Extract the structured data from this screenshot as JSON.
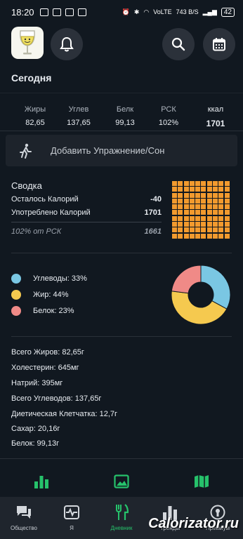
{
  "status": {
    "time": "18:20",
    "network": "VoLTE",
    "speed": "743 B/S",
    "battery": "42"
  },
  "title": "Сегодня",
  "macros": [
    {
      "label": "Жиры",
      "value": "82,65"
    },
    {
      "label": "Углев",
      "value": "137,65"
    },
    {
      "label": "Белк",
      "value": "99,13"
    },
    {
      "label": "РСК",
      "value": "102%"
    },
    {
      "label": "ккал",
      "value": "1701"
    }
  ],
  "exercise_label": "Добавить Упражнение/Сон",
  "summary": {
    "title": "Сводка",
    "remaining_label": "Осталось Калорий",
    "remaining_value": "-40",
    "consumed_label": "Употреблено Калорий",
    "consumed_value": "1701",
    "rdi_label": "102% от РСК",
    "rdi_value": "1661",
    "grid_fill_fraction": 1.0
  },
  "breakdown": {
    "items": [
      {
        "label": "Углеводы: 33%",
        "percent": 33,
        "color": "#7ac7e3"
      },
      {
        "label": "Жир: 44%",
        "percent": 44,
        "color": "#f5c94f"
      },
      {
        "label": "Белок: 23%",
        "percent": 23,
        "color": "#f08a87"
      }
    ]
  },
  "nutrients": [
    "Всего Жиров: 82,65г",
    "Холестерин: 645мг",
    "Натрий: 395мг",
    "Всего Углеводов: 137,65г",
    "Диетическая Клетчатка: 12,7г",
    "Сахар: 20,16г",
    "Белок: 99,13г"
  ],
  "tabs": [
    {
      "label": "Общество"
    },
    {
      "label": "Я"
    },
    {
      "label": "Дневник"
    },
    {
      "label": "Тренды"
    },
    {
      "label": "Премиум"
    }
  ],
  "watermark": "Calorizator.ru",
  "colors": {
    "accent": "#26c26b",
    "grid": "#f29a2e"
  }
}
